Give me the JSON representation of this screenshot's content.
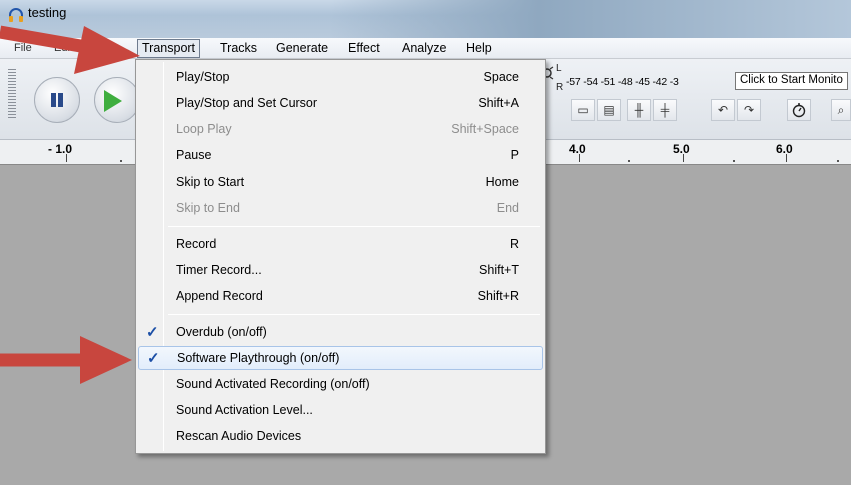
{
  "window": {
    "title": "testing"
  },
  "menubar": {
    "left_partial": [
      "File",
      "Edit"
    ],
    "items": [
      {
        "label": "Transport",
        "active": true
      },
      {
        "label": "Tracks",
        "active": false
      },
      {
        "label": "Generate",
        "active": false
      },
      {
        "label": "Effect",
        "active": false
      },
      {
        "label": "Analyze",
        "active": false
      },
      {
        "label": "Help",
        "active": false
      }
    ]
  },
  "meter": {
    "l_label": "L",
    "r_label": "R",
    "scale": "-57 -54 -51 -48 -45 -42 -3",
    "tooltip": "Click to Start Monito"
  },
  "ruler": {
    "labels": [
      "- 1.0",
      "4.0",
      "5.0",
      "6.0"
    ]
  },
  "transport_menu": {
    "items": [
      {
        "label": "Play/Stop",
        "shortcut": "Space",
        "enabled": true,
        "checked": false
      },
      {
        "label": "Play/Stop and Set Cursor",
        "shortcut": "Shift+A",
        "enabled": true,
        "checked": false
      },
      {
        "label": "Loop Play",
        "shortcut": "Shift+Space",
        "enabled": false,
        "checked": false
      },
      {
        "label": "Pause",
        "shortcut": "P",
        "enabled": true,
        "checked": false
      },
      {
        "label": "Skip to Start",
        "shortcut": "Home",
        "enabled": true,
        "checked": false
      },
      {
        "label": "Skip to End",
        "shortcut": "End",
        "enabled": false,
        "checked": false
      },
      {
        "label": "Record",
        "shortcut": "R",
        "enabled": true,
        "checked": false
      },
      {
        "label": "Timer Record...",
        "shortcut": "Shift+T",
        "enabled": true,
        "checked": false
      },
      {
        "label": "Append Record",
        "shortcut": "Shift+R",
        "enabled": true,
        "checked": false
      },
      {
        "label": "Overdub (on/off)",
        "shortcut": "",
        "enabled": true,
        "checked": true
      },
      {
        "label": "Software Playthrough (on/off)",
        "shortcut": "",
        "enabled": true,
        "checked": true,
        "highlighted": true
      },
      {
        "label": "Sound Activated Recording (on/off)",
        "shortcut": "",
        "enabled": true,
        "checked": false
      },
      {
        "label": "Sound Activation Level...",
        "shortcut": "",
        "enabled": true,
        "checked": false
      },
      {
        "label": "Rescan Audio Devices",
        "shortcut": "",
        "enabled": true,
        "checked": false
      }
    ]
  },
  "icons": {
    "app": "headphones-icon",
    "check": "✓",
    "undo": "↶",
    "redo": "↷",
    "timer": "stopwatch-icon"
  },
  "colors": {
    "annotation_arrow": "#c8463e",
    "check": "#1c4fa6",
    "highlight": "#e2edfb"
  }
}
